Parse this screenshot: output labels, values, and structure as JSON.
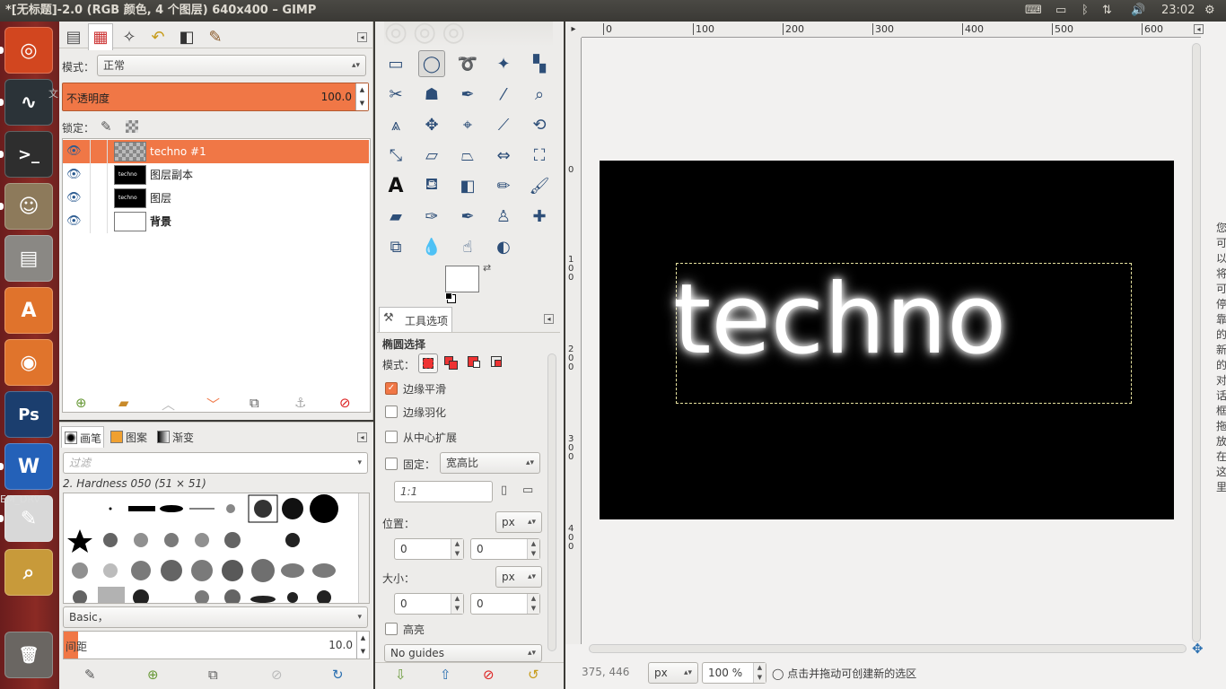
{
  "window_title": "*[无标题]-2.0 (RGB 颜色, 4 个图层) 640x400 – GIMP",
  "clock": "23:02",
  "tray": {
    "keyboard_icon": "keyboard-icon",
    "battery_icon": "battery-icon",
    "bluetooth_icon": "bluetooth-icon",
    "network_icon": "network-icon",
    "volume_icon": "volume-icon",
    "power_icon": "power-gear-icon"
  },
  "launcher": [
    {
      "name": "ubuntu-dash",
      "color": "#d2461f",
      "glyph": "◎"
    },
    {
      "name": "system-monitor",
      "color": "#2b3338",
      "glyph": "∿"
    },
    {
      "name": "terminal",
      "color": "#2e2e2e",
      "glyph": ">_"
    },
    {
      "name": "gimp",
      "color": "#8d7a5b",
      "glyph": "☺"
    },
    {
      "name": "files",
      "color": "#8a8884",
      "glyph": "▤"
    },
    {
      "name": "software-center",
      "color": "#e0732c",
      "glyph": "A"
    },
    {
      "name": "firefox",
      "color": "#e0742c",
      "glyph": "◉"
    },
    {
      "name": "photoshop",
      "color": "#1b3e6e",
      "glyph": "Ps"
    },
    {
      "name": "wps-writer",
      "color": "#2461b8",
      "glyph": "W"
    },
    {
      "name": "pdf-reader",
      "color": "#d8d8d8",
      "glyph": "✎"
    },
    {
      "name": "image-viewer",
      "color": "#c89a3a",
      "glyph": "⌕"
    },
    {
      "name": "trash",
      "color": "#6a6662",
      "glyph": "🗑"
    }
  ],
  "launcher_overlay": {
    "text1": "文",
    "text2": "EM_DRV"
  },
  "layers_panel": {
    "mode_label": "模式：",
    "mode_value": "正常",
    "opacity_label": "不透明度",
    "opacity_value": "100.0",
    "lock_label": "锁定：",
    "layers": [
      {
        "name": "techno #1",
        "selected": true,
        "bold": false
      },
      {
        "name": "图层副本",
        "selected": false,
        "bold": false
      },
      {
        "name": "图层",
        "selected": false,
        "bold": false
      },
      {
        "name": "背景",
        "selected": false,
        "bold": true
      }
    ],
    "thumb_text": "techno"
  },
  "brushes_panel": {
    "tabs": [
      {
        "label": "画笔"
      },
      {
        "label": "图案"
      },
      {
        "label": "渐变"
      }
    ],
    "filter_placeholder": "过滤",
    "brush_name": "2. Hardness 050 (51 × 51)",
    "preset_value": "Basic，",
    "spacing_label": "间距",
    "spacing_value": "10.0"
  },
  "tool_options": {
    "tab_label": "工具选项",
    "tool_title": "椭圆选择",
    "mode_label": "模式：",
    "antialias_label": "边缘平滑",
    "feather_label": "边缘羽化",
    "expand_label": "从中心扩展",
    "fixed_label": "固定：",
    "fixed_value": "宽高比",
    "ratio_value": "1:1",
    "position_label": "位置：",
    "size_label": "大小：",
    "unit": "px",
    "pos_x": "0",
    "pos_y": "0",
    "size_w": "0",
    "size_h": "0",
    "highlight_label": "高亮",
    "guides_value": "No guides"
  },
  "canvas": {
    "ruler_top": [
      "0",
      "100",
      "200",
      "300",
      "400",
      "500",
      "600"
    ],
    "ruler_left": [
      "0",
      "1\n0\n0",
      "2\n0\n0",
      "3\n0\n0",
      "4\n0\n0"
    ],
    "text": "techno",
    "status_coords": "375, 446",
    "status_unit": "px",
    "status_zoom": "100 %",
    "status_msg": "点击并拖动可创建新的选区"
  },
  "side_vertical_text": "您可以将可停靠的新的对话框拖放在这里",
  "colors": {
    "accent": "#f07746",
    "canvas_bg": "#000000",
    "selection": "#e8e3a0"
  }
}
